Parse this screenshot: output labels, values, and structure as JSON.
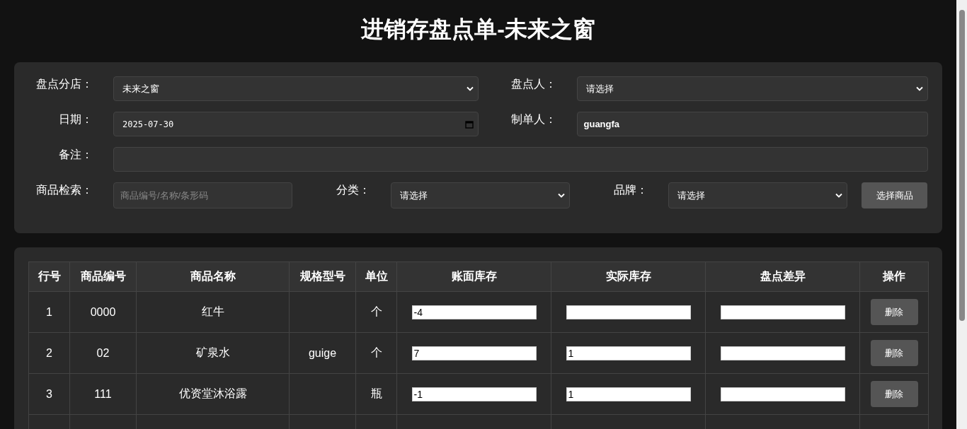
{
  "title": "进销存盘点单-未来之窗",
  "form": {
    "rows": [
      [
        {
          "label": "盘点分店：",
          "kind": "select",
          "value": "未来之窗"
        },
        {
          "label": "盘点人：",
          "kind": "select",
          "value": "请选择"
        }
      ],
      [
        {
          "label": "日期：",
          "kind": "date",
          "value": "2025-07-30"
        },
        {
          "label": "制单人：",
          "kind": "text",
          "value": "guangfa"
        }
      ],
      [
        {
          "label": "备注：",
          "kind": "text"
        }
      ]
    ],
    "search": [
      {
        "label": "商品检索：",
        "kind": "text",
        "placeholder": "商品编号/名称/条形码"
      },
      {
        "label": "分类：",
        "kind": "select",
        "value": "请选择"
      },
      {
        "label": "品牌：",
        "kind": "select",
        "value": "请选择"
      }
    ],
    "button": "选择商品"
  },
  "table": {
    "columns": [
      "行号",
      "商品编号",
      "商品名称",
      "规格型号",
      "单位",
      "账面库存",
      "实际库存",
      "盘点差异",
      "操作"
    ],
    "rows": [
      {
        "no": "1",
        "code": "0000",
        "name": "红牛",
        "unit": "个",
        "book": "-4",
        "action": "删除"
      },
      {
        "no": "2",
        "code": "02",
        "name": "矿泉水",
        "spec": "guige",
        "unit": "个",
        "book": "7",
        "actual": "1",
        "action": "删除"
      },
      {
        "no": "3",
        "code": "111",
        "name": "优资堂沐浴露",
        "unit": "瓶",
        "book": "-1",
        "actual": "1",
        "action": "删除"
      }
    ]
  }
}
